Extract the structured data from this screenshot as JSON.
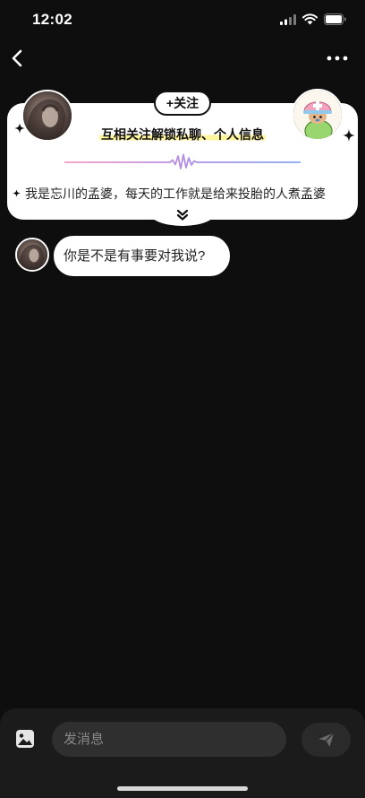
{
  "status_bar": {
    "time": "12:02",
    "icons": [
      "signal-icon",
      "wifi-icon",
      "battery-icon"
    ]
  },
  "nav": {
    "back_icon": "chevron-left-icon",
    "more_icon": "more-dots-icon"
  },
  "profile_card": {
    "follow_label": "+关注",
    "headline": "互相关注解锁私聊、个人信息",
    "intro": "我是忘川的孟婆，每天的工作就是给来投胎的人煮孟婆",
    "decor_icons": [
      "sparkle-icon",
      "waveform-divider",
      "double-chevron-down-icon"
    ]
  },
  "messages": [
    {
      "text": "你是不是有事要对我说?"
    }
  ],
  "composer": {
    "placeholder": "发消息",
    "image_icon": "image-icon",
    "send_icon": "send-icon"
  },
  "colors": {
    "background": "#0e0e0e",
    "card": "#ffffff",
    "highlight": "#fff59d",
    "composer_bar": "#1b1b1b",
    "input_field": "#2f2f2f",
    "send_button": "#2a2a2a",
    "divider_gradient": [
      "#f39bc3",
      "#b48ee3",
      "#86a8f2"
    ]
  }
}
